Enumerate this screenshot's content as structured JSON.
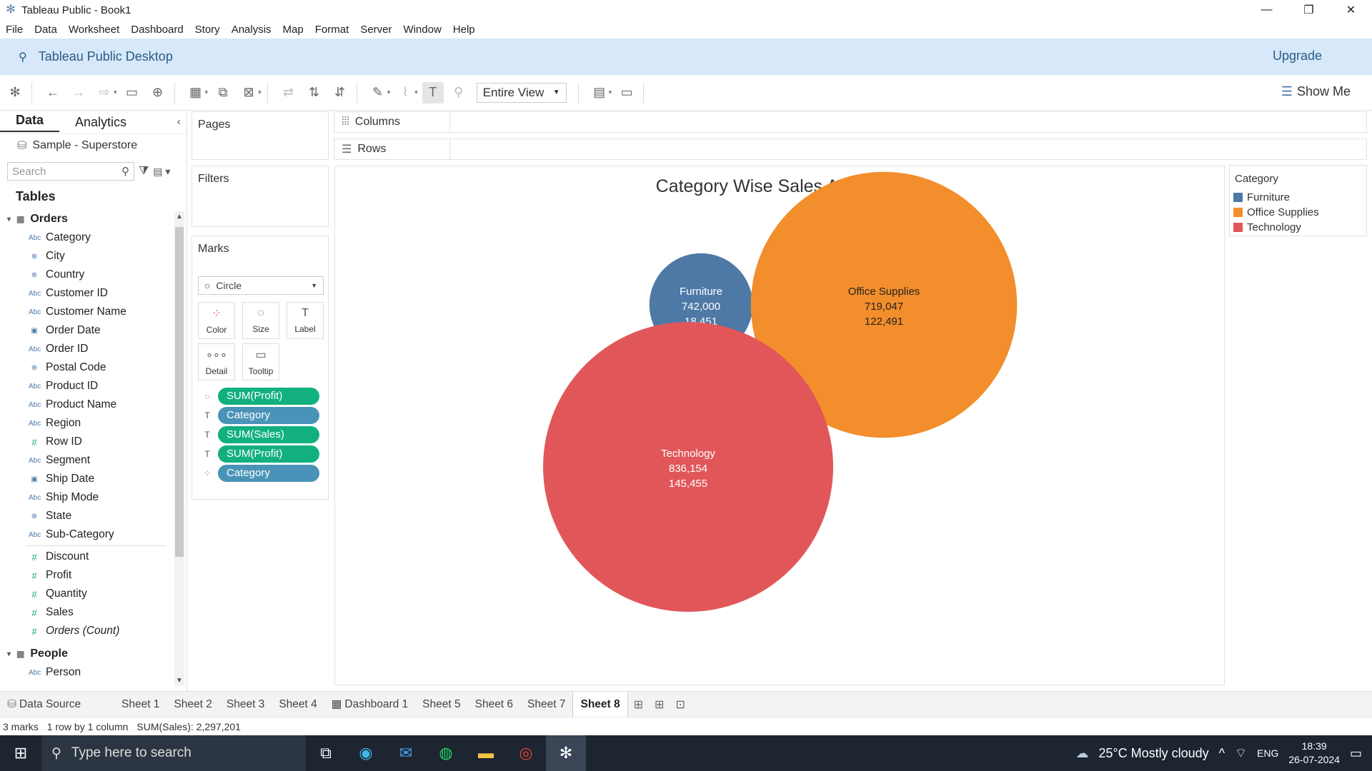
{
  "window": {
    "title": "Tableau Public - Book1"
  },
  "menu": [
    "File",
    "Data",
    "Worksheet",
    "Dashboard",
    "Story",
    "Analysis",
    "Map",
    "Format",
    "Server",
    "Window",
    "Help"
  ],
  "banner": {
    "title": "Tableau Public Desktop",
    "upgrade": "Upgrade"
  },
  "toolbar": {
    "view_mode": "Entire View",
    "show_me": "Show Me"
  },
  "datapane": {
    "tab_data": "Data",
    "tab_analytics": "Analytics",
    "source": "Sample - Superstore",
    "search_placeholder": "Search",
    "tables_header": "Tables",
    "groups": [
      {
        "name": "Orders",
        "fields": [
          {
            "icon": "Abc",
            "name": "Category"
          },
          {
            "icon": "globe",
            "name": "City"
          },
          {
            "icon": "globe",
            "name": "Country"
          },
          {
            "icon": "Abc",
            "name": "Customer ID"
          },
          {
            "icon": "Abc",
            "name": "Customer Name"
          },
          {
            "icon": "date",
            "name": "Order Date"
          },
          {
            "icon": "Abc",
            "name": "Order ID"
          },
          {
            "icon": "globe",
            "name": "Postal Code"
          },
          {
            "icon": "Abc",
            "name": "Product ID"
          },
          {
            "icon": "Abc",
            "name": "Product Name"
          },
          {
            "icon": "Abc",
            "name": "Region"
          },
          {
            "icon": "#",
            "name": "Row ID"
          },
          {
            "icon": "Abc",
            "name": "Segment"
          },
          {
            "icon": "date",
            "name": "Ship Date"
          },
          {
            "icon": "Abc",
            "name": "Ship Mode"
          },
          {
            "icon": "globe",
            "name": "State"
          },
          {
            "icon": "Abc",
            "name": "Sub-Category"
          }
        ],
        "measures": [
          {
            "icon": "#",
            "name": "Discount"
          },
          {
            "icon": "#",
            "name": "Profit"
          },
          {
            "icon": "#",
            "name": "Quantity"
          },
          {
            "icon": "#",
            "name": "Sales"
          },
          {
            "icon": "#",
            "name": "Orders (Count)"
          }
        ]
      },
      {
        "name": "People",
        "fields": [
          {
            "icon": "Abc",
            "name": "Person"
          }
        ],
        "measures": []
      }
    ]
  },
  "shelves": {
    "pages": "Pages",
    "filters": "Filters",
    "marks": "Marks",
    "columns": "Columns",
    "rows": "Rows"
  },
  "marks": {
    "type": "Circle",
    "buttons": [
      "Color",
      "Size",
      "Label",
      "Detail",
      "Tooltip"
    ],
    "pills": [
      {
        "kind": "size",
        "label": "SUM(Profit)",
        "measure": true
      },
      {
        "kind": "label",
        "label": "Category",
        "measure": false
      },
      {
        "kind": "label",
        "label": "SUM(Sales)",
        "measure": true
      },
      {
        "kind": "label",
        "label": "SUM(Profit)",
        "measure": true
      },
      {
        "kind": "color",
        "label": "Category",
        "measure": false
      }
    ]
  },
  "chart_data": {
    "type": "bubble",
    "title": "Category Wise Sales And Profit",
    "size_by": "SUM(Profit)",
    "labels": [
      "Category",
      "SUM(Sales)",
      "SUM(Profit)"
    ],
    "points": [
      {
        "category": "Furniture",
        "sales": "742,000",
        "profit": "18,451",
        "profit_value": 18451,
        "color": "#4e79a7"
      },
      {
        "category": "Office Supplies",
        "sales": "719,047",
        "profit": "122,491",
        "profit_value": 122491,
        "color": "#f28e2b"
      },
      {
        "category": "Technology",
        "sales": "836,154",
        "profit": "145,455",
        "profit_value": 145455,
        "color": "#e15759"
      }
    ]
  },
  "legend": {
    "title": "Category",
    "items": [
      {
        "label": "Furniture",
        "color": "#4e79a7"
      },
      {
        "label": "Office Supplies",
        "color": "#f28e2b"
      },
      {
        "label": "Technology",
        "color": "#e15759"
      }
    ]
  },
  "sheet_tabs": {
    "data_source": "Data Source",
    "tabs": [
      "Sheet 1",
      "Sheet 2",
      "Sheet 3",
      "Sheet 4",
      "Dashboard 1",
      "Sheet 5",
      "Sheet 6",
      "Sheet 7",
      "Sheet 8"
    ],
    "active": "Sheet 8"
  },
  "status": {
    "marks": "3 marks",
    "dims": "1 row by 1 column",
    "sum": "SUM(Sales): 2,297,201"
  },
  "taskbar": {
    "search": "Type here to search",
    "weather": "25°C  Mostly cloudy",
    "lang": "ENG",
    "time": "18:39",
    "date": "26-07-2024"
  }
}
